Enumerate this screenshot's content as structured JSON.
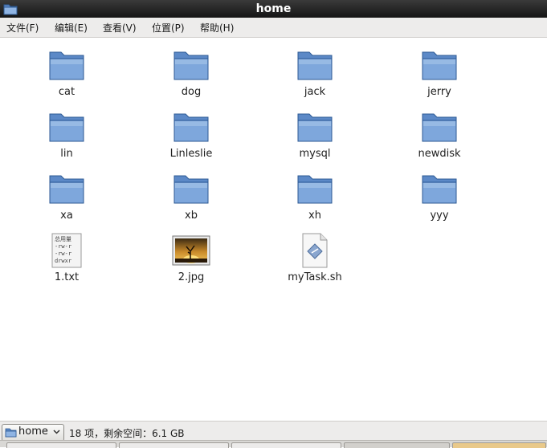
{
  "window": {
    "title": "home",
    "folder_icon": "folder-icon"
  },
  "menu": [
    "文件(F)",
    "编辑(E)",
    "查看(V)",
    "位置(P)",
    "帮助(H)"
  ],
  "items": [
    {
      "name": "cat",
      "icon": "folder-icon"
    },
    {
      "name": "dog",
      "icon": "folder-icon"
    },
    {
      "name": "jack",
      "icon": "folder-icon"
    },
    {
      "name": "jerry",
      "icon": "folder-icon"
    },
    {
      "name": "lin",
      "icon": "folder-icon"
    },
    {
      "name": "Linleslie",
      "icon": "folder-icon"
    },
    {
      "name": "mysql",
      "icon": "folder-icon"
    },
    {
      "name": "newdisk",
      "icon": "folder-icon"
    },
    {
      "name": "xa",
      "icon": "folder-icon"
    },
    {
      "name": "xb",
      "icon": "folder-icon"
    },
    {
      "name": "xh",
      "icon": "folder-icon"
    },
    {
      "name": "yyy",
      "icon": "folder-icon"
    },
    {
      "name": "1.txt",
      "icon": "text-file-icon",
      "preview_lines": [
        "总用量",
        "-rw-r",
        "-rw-r",
        "drwxr"
      ]
    },
    {
      "name": "2.jpg",
      "icon": "image-thumbnail-icon"
    },
    {
      "name": "myTask.sh",
      "icon": "script-file-icon"
    }
  ],
  "status": {
    "location": "home",
    "location_icon": "folder-icon",
    "info": "18 项，剩余空间：6.1 GB"
  },
  "colors": {
    "titlebar": "#1e1e1e",
    "folder_blue": "#6f9bd3",
    "menubar": "#edeceb"
  }
}
